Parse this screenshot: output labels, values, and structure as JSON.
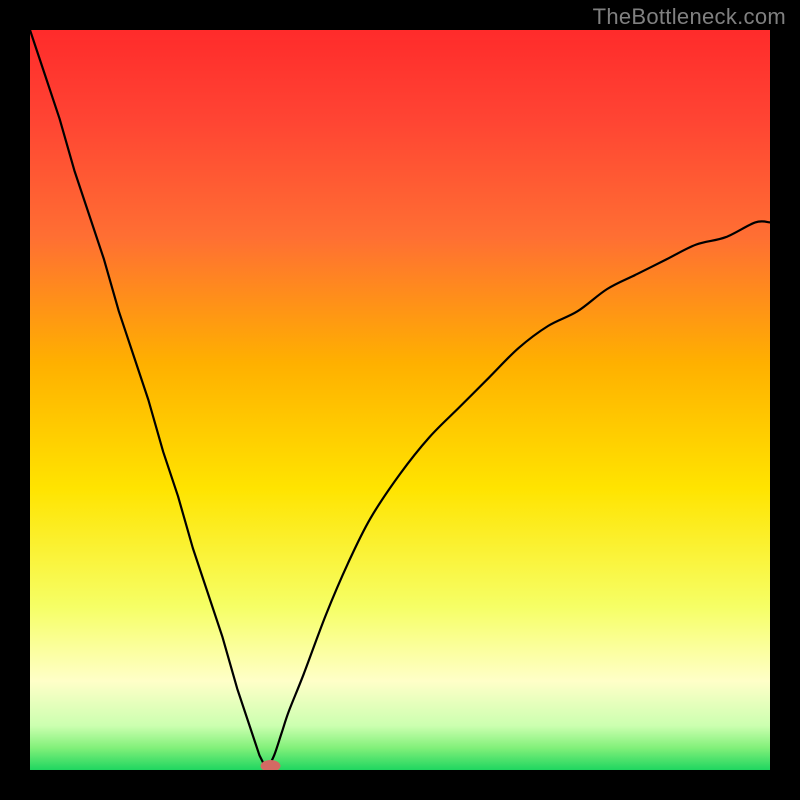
{
  "watermark": "TheBottleneck.com",
  "chart_data": {
    "type": "line",
    "title": "",
    "xlabel": "",
    "ylabel": "",
    "xlim": [
      0,
      100
    ],
    "ylim": [
      0,
      100
    ],
    "x": [
      0,
      2,
      4,
      6,
      8,
      10,
      12,
      14,
      16,
      18,
      20,
      22,
      24,
      26,
      28,
      30,
      31,
      32,
      33,
      34,
      35,
      37,
      40,
      43,
      46,
      50,
      54,
      58,
      62,
      66,
      70,
      74,
      78,
      82,
      86,
      90,
      94,
      98,
      100
    ],
    "values": [
      100,
      94,
      88,
      81,
      75,
      69,
      62,
      56,
      50,
      43,
      37,
      30,
      24,
      18,
      11,
      5,
      2,
      0,
      2,
      5,
      8,
      13,
      21,
      28,
      34,
      40,
      45,
      49,
      53,
      57,
      60,
      62,
      65,
      67,
      69,
      71,
      72,
      74,
      74
    ],
    "marker": {
      "x": 32.5,
      "y": 0
    },
    "background_gradient": {
      "stops": [
        {
          "pos": 0.0,
          "color": "#ff2b2b"
        },
        {
          "pos": 0.12,
          "color": "#ff4433"
        },
        {
          "pos": 0.28,
          "color": "#ff6f33"
        },
        {
          "pos": 0.45,
          "color": "#ffb000"
        },
        {
          "pos": 0.62,
          "color": "#ffe400"
        },
        {
          "pos": 0.78,
          "color": "#f6ff66"
        },
        {
          "pos": 0.88,
          "color": "#ffffc8"
        },
        {
          "pos": 0.94,
          "color": "#ccffb0"
        },
        {
          "pos": 0.97,
          "color": "#82f07a"
        },
        {
          "pos": 1.0,
          "color": "#1fd660"
        }
      ]
    }
  }
}
